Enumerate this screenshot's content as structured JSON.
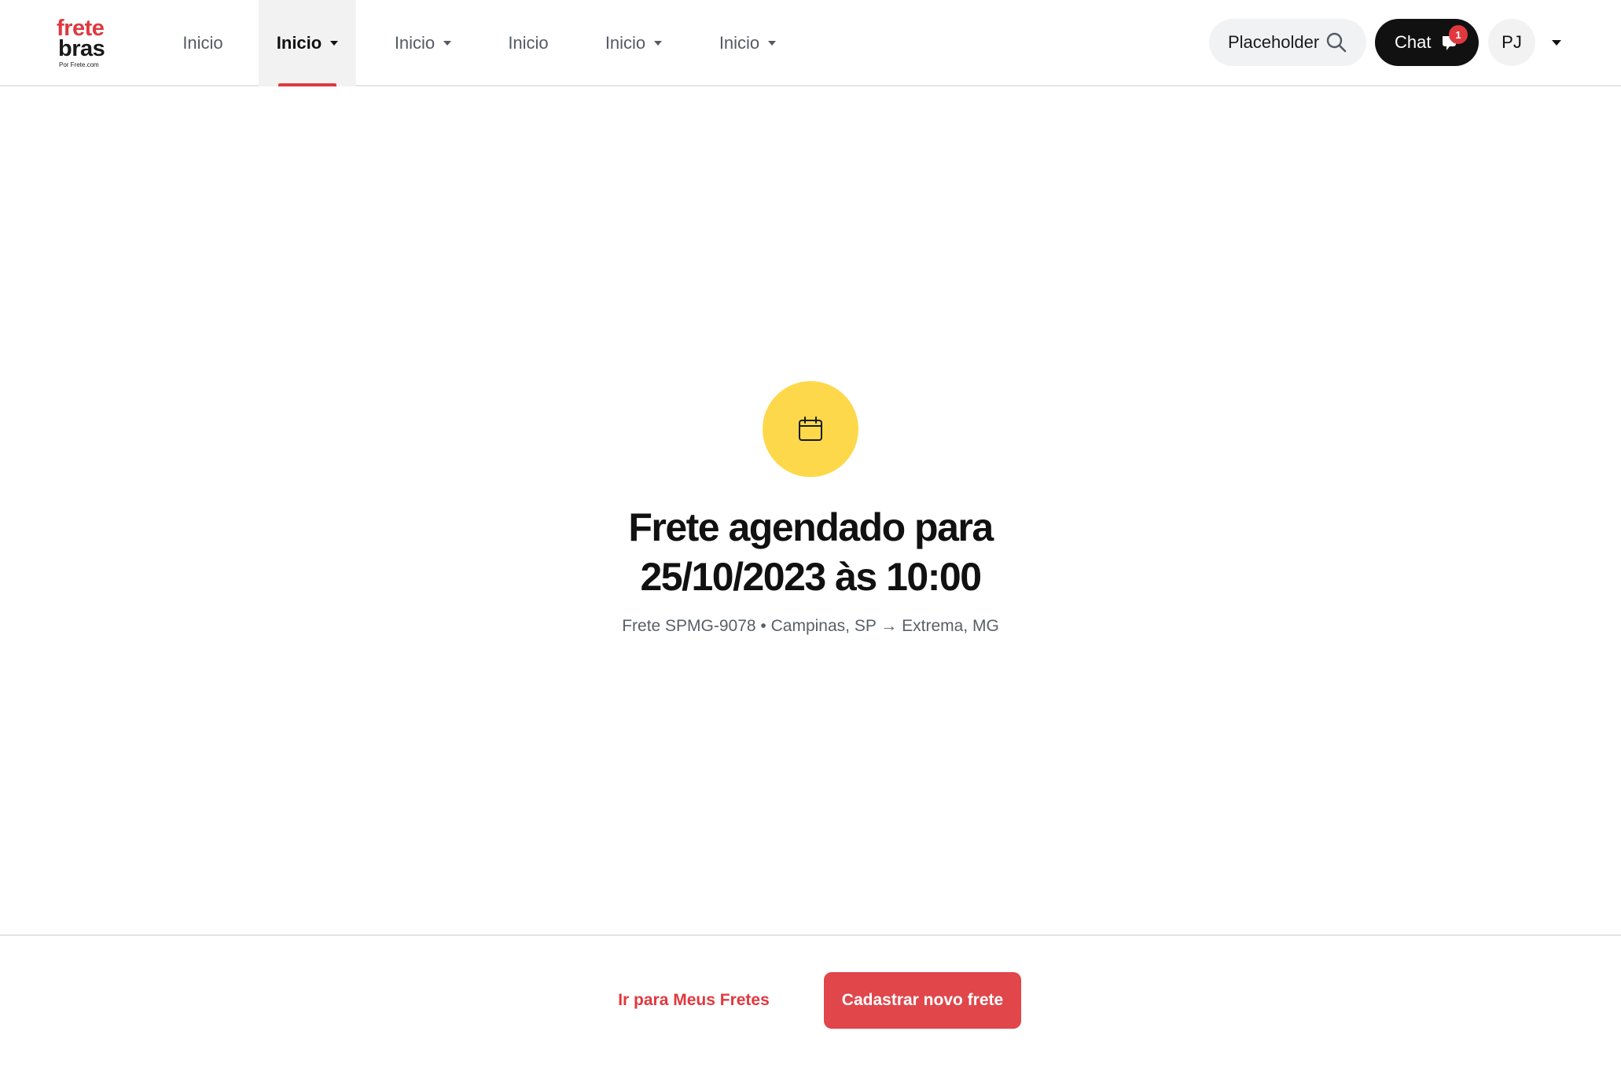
{
  "brand": {
    "line1": "frete",
    "line2": "bras",
    "tagline": "Por Frete.com",
    "accent_color": "#e0383f"
  },
  "nav": {
    "items": [
      {
        "label": "Inicio",
        "dropdown": false,
        "active": false
      },
      {
        "label": "Inicio",
        "dropdown": true,
        "active": true
      },
      {
        "label": "Inicio",
        "dropdown": true,
        "active": false
      },
      {
        "label": "Inicio",
        "dropdown": false,
        "active": false
      },
      {
        "label": "Inicio",
        "dropdown": true,
        "active": false
      },
      {
        "label": "Inicio",
        "dropdown": true,
        "active": false
      }
    ]
  },
  "search": {
    "placeholder": "Placeholder",
    "icon": "search-icon"
  },
  "chat": {
    "label": "Chat",
    "icon": "chat-bubble-icon",
    "badge_count": "1"
  },
  "user": {
    "initials": "PJ",
    "menu_icon": "caret-down-icon"
  },
  "confirmation": {
    "icon": "calendar-icon",
    "icon_bg_color": "#fdd84a",
    "title_line1": "Frete agendado para",
    "title_line2": "25/10/2023 às 10:00",
    "subtitle": "Frete SPMG-9078 • Campinas, SP → Extrema, MG"
  },
  "actions": {
    "secondary_label": "Ir para Meus Fretes",
    "primary_label": "Cadastrar novo frete",
    "primary_color": "#e0464a"
  }
}
